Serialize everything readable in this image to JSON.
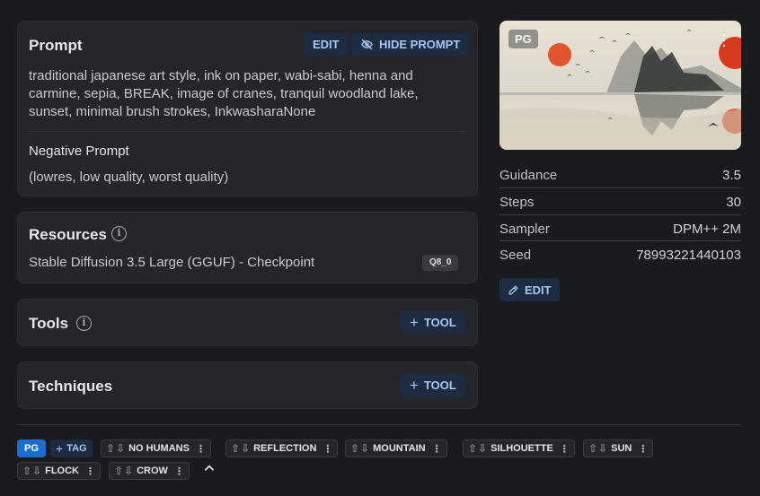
{
  "prompt_card": {
    "title": "Prompt",
    "edit_label": "EDIT",
    "hide_label": "HIDE PROMPT",
    "prompt_text": "traditional japanese art style, ink on paper, wabi-sabi, henna and carmine, sepia, BREAK, image of cranes, tranquil woodland lake, sunset, minimal brush strokes, InkwasharaNone",
    "negative_title": "Negative Prompt",
    "negative_text": "(lowres, low quality, worst quality)"
  },
  "resources_card": {
    "title": "Resources",
    "resource_name": "Stable Diffusion 3.5 Large (GGUF) - Checkpoint",
    "resource_badge": "Q8_0"
  },
  "tools_card": {
    "title": "Tools",
    "add_label": "TOOL"
  },
  "techniques_card": {
    "title": "Techniques",
    "add_label": "TOOL"
  },
  "image": {
    "rating_badge": "PG"
  },
  "meta": {
    "rows": [
      {
        "label": "Guidance",
        "value": "3.5"
      },
      {
        "label": "Steps",
        "value": "30"
      },
      {
        "label": "Sampler",
        "value": "DPM++ 2M"
      },
      {
        "label": "Seed",
        "value": "78993221440103"
      }
    ],
    "edit_label": "EDIT"
  },
  "tags": {
    "rating": "PG",
    "add_label": "TAG",
    "items": [
      "NO HUMANS",
      "REFLECTION",
      "MOUNTAIN",
      "SILHOUETTE",
      "SUN",
      "FLOCK",
      "CROW"
    ]
  },
  "colors": {
    "background": "#1a1b1e",
    "card": "#25262b",
    "accent_button_bg": "#1d2b43",
    "accent_button_text": "#a5c8f3",
    "rating_badge": "#1c6dd0"
  }
}
